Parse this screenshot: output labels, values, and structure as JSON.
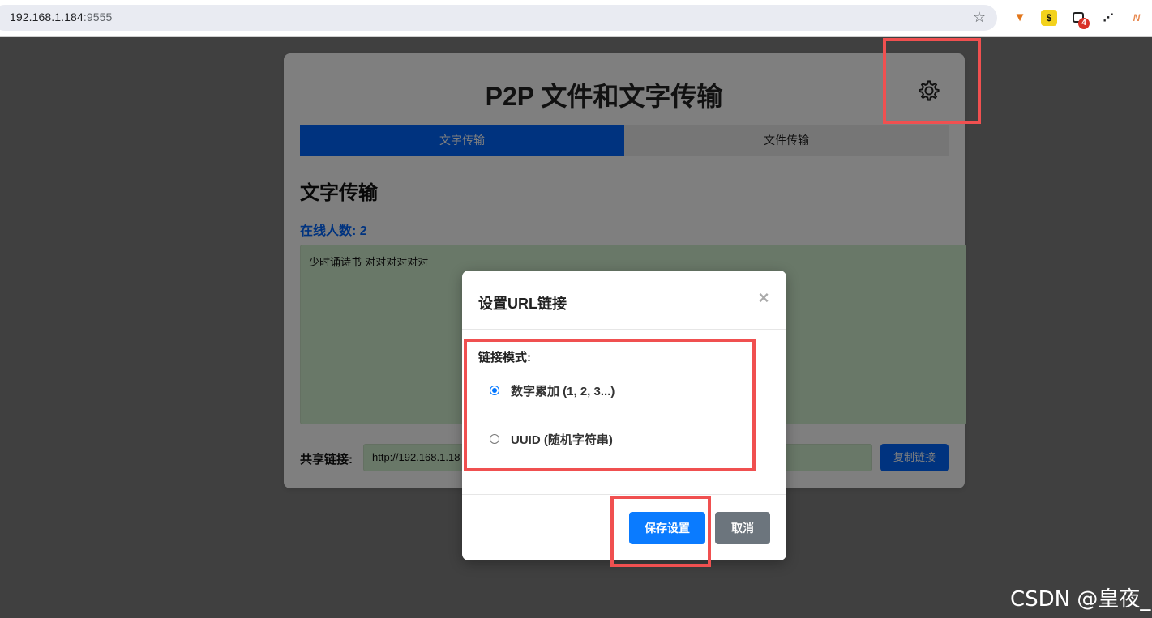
{
  "browser": {
    "url_host": "192.168.1.184",
    "url_port": ":9555",
    "extension_badge": "4"
  },
  "card": {
    "title": "P2P 文件和文字传输",
    "tabs": [
      {
        "label": "文字传输",
        "active": true
      },
      {
        "label": "文件传输",
        "active": false
      }
    ],
    "section_title": "文字传输",
    "online_count": "在线人数: 2",
    "text_content": "少时诵诗书   对对对对对对",
    "share_label": "共享链接:",
    "share_value": "http://192.168.1.18",
    "copy_label": "复制链接"
  },
  "modal": {
    "title": "设置URL链接",
    "close_symbol": "×",
    "mode_label": "链接模式:",
    "options": [
      {
        "label": "数字累加 (1, 2, 3...)",
        "checked": true
      },
      {
        "label": "UUID (随机字符串)",
        "checked": false
      }
    ],
    "save_label": "保存设置",
    "cancel_label": "取消"
  },
  "watermark": "CSDN @皇夜_",
  "colors": {
    "accent": "#0066ff",
    "text_area_bg": "#d3f0d0",
    "annotation": "#f05050",
    "cancel": "#6c757d"
  }
}
